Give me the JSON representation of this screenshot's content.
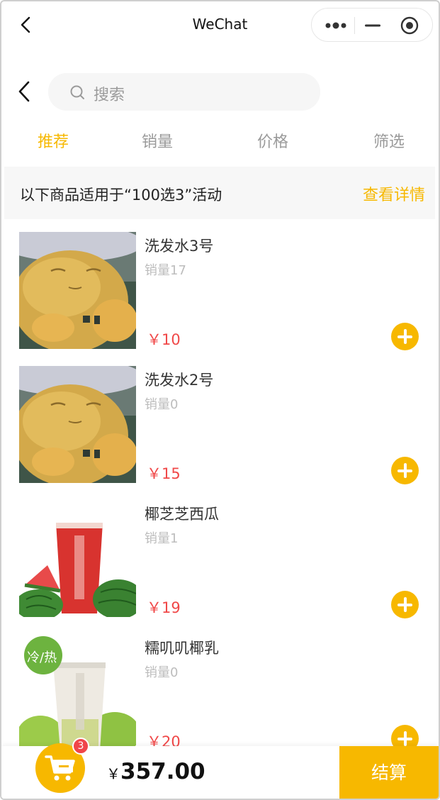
{
  "window": {
    "title": "WeChat"
  },
  "search": {
    "placeholder": "搜索"
  },
  "tabs": [
    {
      "label": "推荐",
      "active": true
    },
    {
      "label": "销量",
      "active": false
    },
    {
      "label": "价格",
      "active": false
    },
    {
      "label": "筛选",
      "active": false
    }
  ],
  "banner": {
    "text": "以下商品适用于“100选3”活动",
    "link": "查看详情"
  },
  "products": [
    {
      "name": "洗发水3号",
      "sales_label": "销量",
      "sales": "17",
      "currency": "￥",
      "price": "10",
      "image": "character-image"
    },
    {
      "name": "洗发水2号",
      "sales_label": "销量",
      "sales": "0",
      "currency": "￥",
      "price": "15",
      "image": "character-image"
    },
    {
      "name": "椰芝芝西瓜",
      "sales_label": "销量",
      "sales": "1",
      "currency": "￥",
      "price": "19",
      "image": "watermelon-drink-image"
    },
    {
      "name": "糯叽叽椰乳",
      "sales_label": "销量",
      "sales": "0",
      "currency": "￥",
      "price": "20",
      "image": "coconut-drink-image",
      "image_tag": "冷/热"
    }
  ],
  "cart": {
    "count": "3",
    "currency": "￥",
    "total": "357.00",
    "checkout_label": "结算"
  },
  "colors": {
    "accent": "#f7b800",
    "price": "#f04848",
    "badge": "#f0464a"
  }
}
